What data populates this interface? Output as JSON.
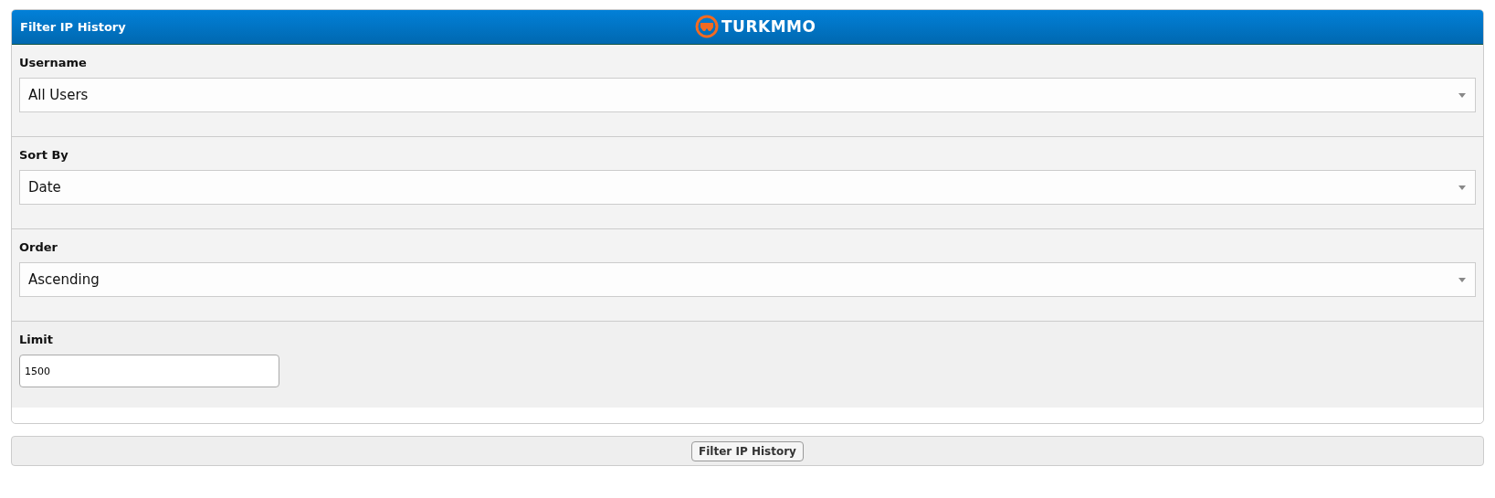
{
  "panel": {
    "title": "Filter IP History",
    "logo": "TURKMMO"
  },
  "fields": [
    {
      "kind": "select",
      "label": "Username",
      "value": "All Users"
    },
    {
      "kind": "select",
      "label": "Sort By",
      "value": "Date"
    },
    {
      "kind": "select",
      "label": "Order",
      "value": "Ascending"
    },
    {
      "kind": "text",
      "label": "Limit",
      "value": "1500"
    }
  ],
  "submit": "Filter IP History"
}
